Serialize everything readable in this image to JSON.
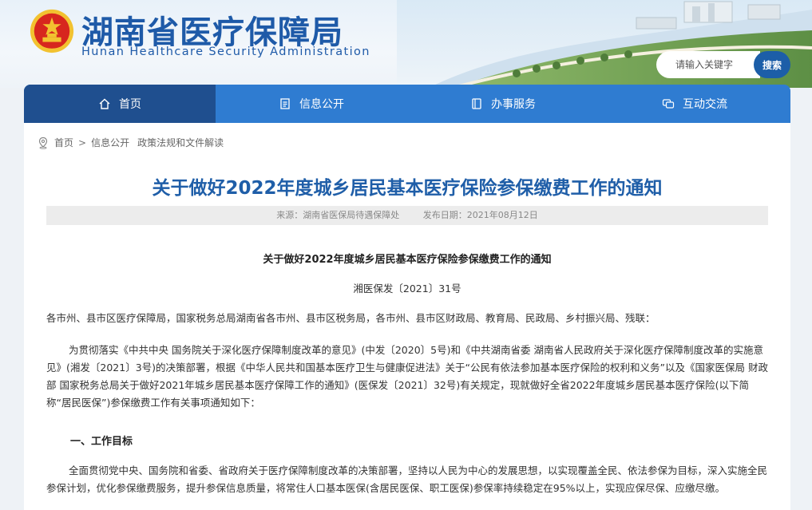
{
  "header": {
    "title_cn": "湖南省医疗保障局",
    "title_en": "Hunan Healthcare Security Administration"
  },
  "search": {
    "placeholder": "请输入关键字",
    "button_label": "搜索"
  },
  "nav": {
    "items": [
      {
        "label": "首页",
        "icon": "home-icon"
      },
      {
        "label": "信息公开",
        "icon": "document-icon"
      },
      {
        "label": "办事服务",
        "icon": "book-icon"
      },
      {
        "label": "互动交流",
        "icon": "chat-icon"
      }
    ]
  },
  "breadcrumb": {
    "home": "首页",
    "separator": ">",
    "level1": "信息公开",
    "level2": "政策法规和文件解读"
  },
  "article": {
    "title": "关于做好2022年度城乡居民基本医疗保险参保缴费工作的通知",
    "source": "来源：湖南省医保局待遇保障处",
    "date": "发布日期：2021年08月12日",
    "doc_title": "关于做好2022年度城乡居民基本医疗保险参保缴费工作的通知",
    "doc_no": "湘医保发〔2021〕31号",
    "addressee": "各市州、县市区医疗保障局，国家税务总局湖南省各市州、县市区税务局，各市州、县市区财政局、教育局、民政局、乡村振兴局、残联：",
    "body": "为贯彻落实《中共中央 国务院关于深化医疗保障制度改革的意见》(中发〔2020〕5号)和《中共湖南省委 湖南省人民政府关于深化医疗保障制度改革的实施意见》(湘发〔2021〕3号)的决策部署，根据《中华人民共和国基本医疗卫生与健康促进法》关于“公民有依法参加基本医疗保险的权利和义务”以及《国家医保局 财政部 国家税务总局关于做好2021年城乡居民基本医疗保障工作的通知》(医保发〔2021〕32号)有关规定，现就做好全省2022年度城乡居民基本医疗保险(以下简称“居民医保”)参保缴费工作有关事项通知如下：",
    "section1_heading": "一、工作目标",
    "section1_body": "全面贯彻党中央、国务院和省委、省政府关于医疗保障制度改革的决策部署，坚持以人民为中心的发展思想，以实现覆盖全民、依法参保为目标，深入实施全民参保计划，优化参保缴费服务，提升参保信息质量，将常住人口基本医保(含居民医保、职工医保)参保率持续稳定在95%以上，实现应保尽保、应缴尽缴。"
  },
  "colors": {
    "brand_blue": "#1e5aa8",
    "nav_blue": "#2f7cd1",
    "nav_active": "#1f4f8f",
    "emblem_red": "#d7261e",
    "emblem_gold": "#f2c230"
  }
}
